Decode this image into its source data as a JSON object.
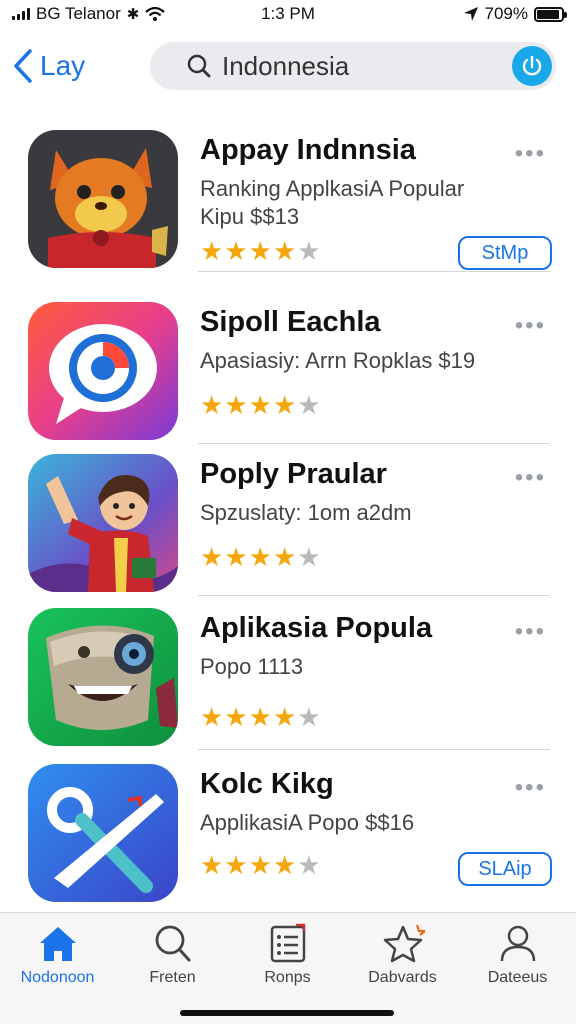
{
  "status_bar": {
    "carrier": "BG Telanor",
    "time": "1:3 PM",
    "battery": "709%",
    "battery_level": 0.9
  },
  "nav": {
    "back_label": "Lay",
    "search_value": "Indonnesia"
  },
  "apps": [
    {
      "title": "Appay Indnnsia",
      "subtitle": "Ranking  ApplkasiA Popular",
      "price": "Kipu $$13",
      "rating": 4,
      "button": "StMp",
      "icon": "fox-mascot-icon"
    },
    {
      "title": "Sipoll Eachla",
      "subtitle": "Apasiasiy: Arrn Ropklas $19",
      "price": "",
      "rating": 4,
      "button": "",
      "icon": "chat-bubble-ring-icon"
    },
    {
      "title": "Poply Praular",
      "subtitle": "Spzuslaty:  1om a2dm",
      "price": "",
      "rating": 4,
      "button": "",
      "icon": "waving-boy-icon"
    },
    {
      "title": "Aplikasia Popula",
      "subtitle": "Popo 1113",
      "price": "",
      "rating": 4,
      "button": "",
      "icon": "robot-camera-icon"
    },
    {
      "title": "Kolc Kikg",
      "subtitle": "ApplikasiA Popo $$16",
      "price": "",
      "rating": 4,
      "button": "SLAip",
      "icon": "scissors-shape-icon"
    }
  ],
  "tabs": [
    {
      "label": "Nodonoon",
      "icon": "home-icon"
    },
    {
      "label": "Freten",
      "icon": "search-icon"
    },
    {
      "label": "Ronps",
      "icon": "list-icon"
    },
    {
      "label": "Dabvards",
      "icon": "star-icon"
    },
    {
      "label": "Dateeus",
      "icon": "person-icon"
    }
  ],
  "colors": {
    "accent": "#1a73e8",
    "star": "#f5a60c",
    "mic": "#1aa8e8"
  }
}
